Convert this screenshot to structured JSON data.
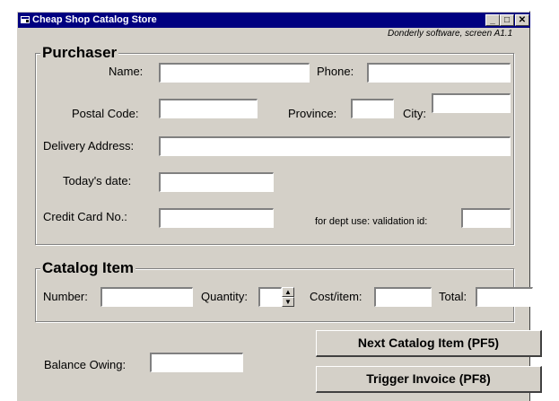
{
  "window": {
    "title": "Cheap Shop Catalog Store",
    "credit": "Donderly software, screen A1.1",
    "controls": {
      "minimize": "_",
      "maximize": "□",
      "close": "✕"
    }
  },
  "purchaser": {
    "heading": "Purchaser",
    "name_label": "Name:",
    "phone_label": "Phone:",
    "postal_code_label": "Postal Code:",
    "province_label": "Province:",
    "city_label": "City:",
    "delivery_address_label": "Delivery Address:",
    "todays_date_label": "Today's date:",
    "credit_card_label": "Credit Card No.:",
    "validation_label": "for dept use: validation id:",
    "values": {
      "name": "",
      "phone": "",
      "postal_code": "",
      "province": "",
      "city": "",
      "delivery_address": "",
      "todays_date": "",
      "credit_card": "",
      "validation_id": ""
    }
  },
  "catalog_item": {
    "heading": "Catalog Item",
    "number_label": "Number:",
    "quantity_label": "Quantity:",
    "cost_label": "Cost/item:",
    "total_label": "Total:",
    "values": {
      "number": "",
      "quantity": "",
      "cost": "",
      "total": ""
    }
  },
  "balance": {
    "label": "Balance Owing:",
    "value": ""
  },
  "buttons": {
    "next_item": "Next Catalog Item (PF5)",
    "trigger_invoice": "Trigger Invoice (PF8)"
  }
}
